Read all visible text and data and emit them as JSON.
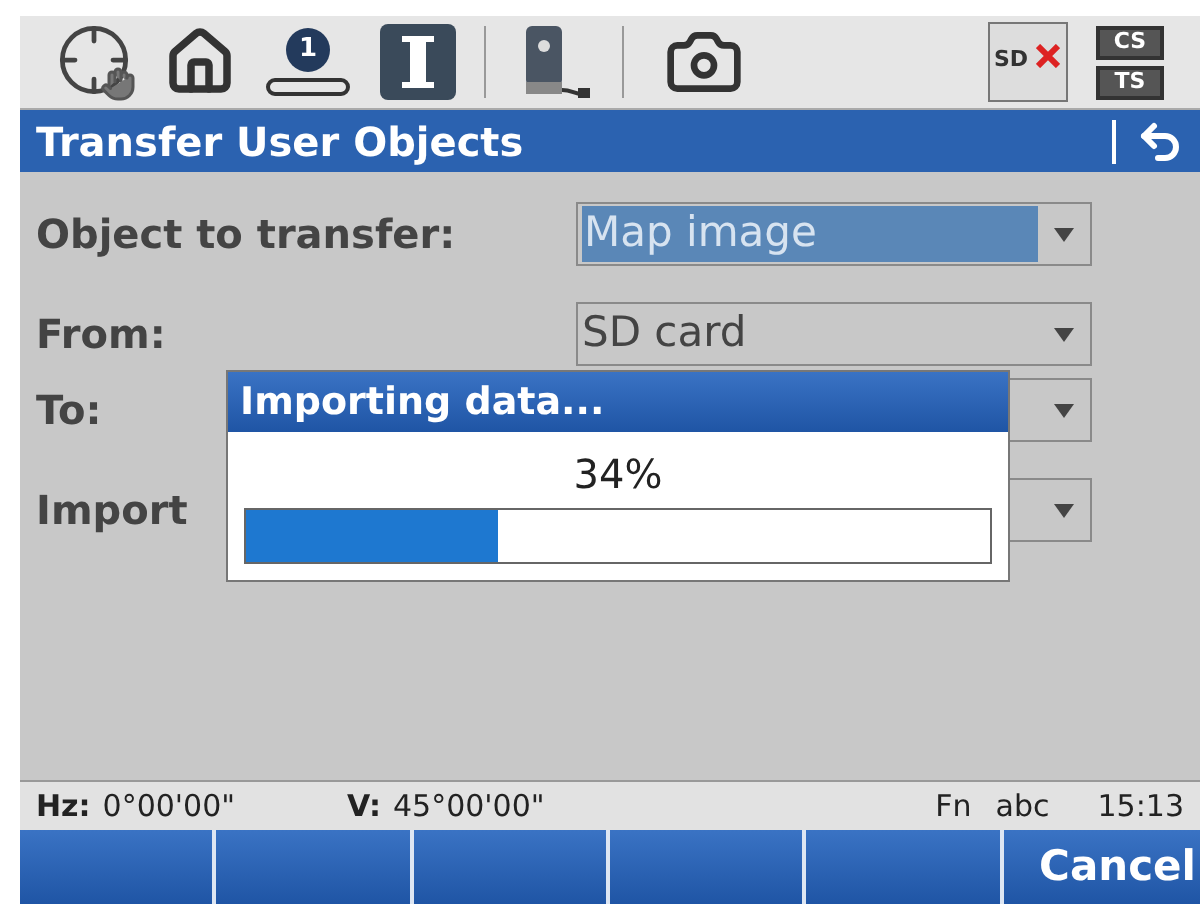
{
  "toolbar": {
    "badge": "1",
    "status_labels": [
      "CS",
      "TS"
    ],
    "sd_label": "SD"
  },
  "title": "Transfer User Objects",
  "fields": [
    {
      "label": "Object to transfer:",
      "value": "Map image",
      "highlighted": true
    },
    {
      "label": "From:",
      "value": "SD card",
      "highlighted": false
    },
    {
      "label": "To:",
      "highlighted": false
    },
    {
      "label": "Import",
      "highlighted": false
    }
  ],
  "dialog": {
    "title": "Importing data...",
    "percent": "34%",
    "level": 0.34
  },
  "status_bar": {
    "hz_label": "Hz:",
    "hz_value": "0°00'00\"",
    "v_label": "V:",
    "v_value": "45°00'00\"",
    "fn": "Fn",
    "mode": "abc",
    "time": "15:13"
  },
  "softkeys": [
    {
      "label": "Cancel"
    }
  ]
}
